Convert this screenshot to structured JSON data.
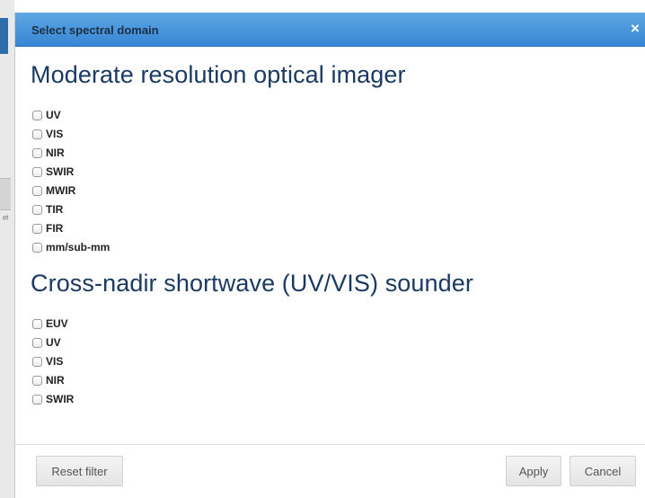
{
  "dialog": {
    "title": "Select spectral domain",
    "close_glyph": "×"
  },
  "background": {
    "glyph": "ᵉᵗ"
  },
  "sections": [
    {
      "title": "Moderate resolution optical imager",
      "options": [
        "UV",
        "VIS",
        "NIR",
        "SWIR",
        "MWIR",
        "TIR",
        "FIR",
        "mm/sub-mm"
      ]
    },
    {
      "title": "Cross-nadir shortwave (UV/VIS) sounder",
      "options": [
        "EUV",
        "UV",
        "VIS",
        "NIR",
        "SWIR"
      ]
    }
  ],
  "footer": {
    "reset_label": "Reset filter",
    "apply_label": "Apply",
    "cancel_label": "Cancel"
  },
  "colors": {
    "titlebar": "#3f8fd8",
    "section_title": "#1b3a63"
  }
}
